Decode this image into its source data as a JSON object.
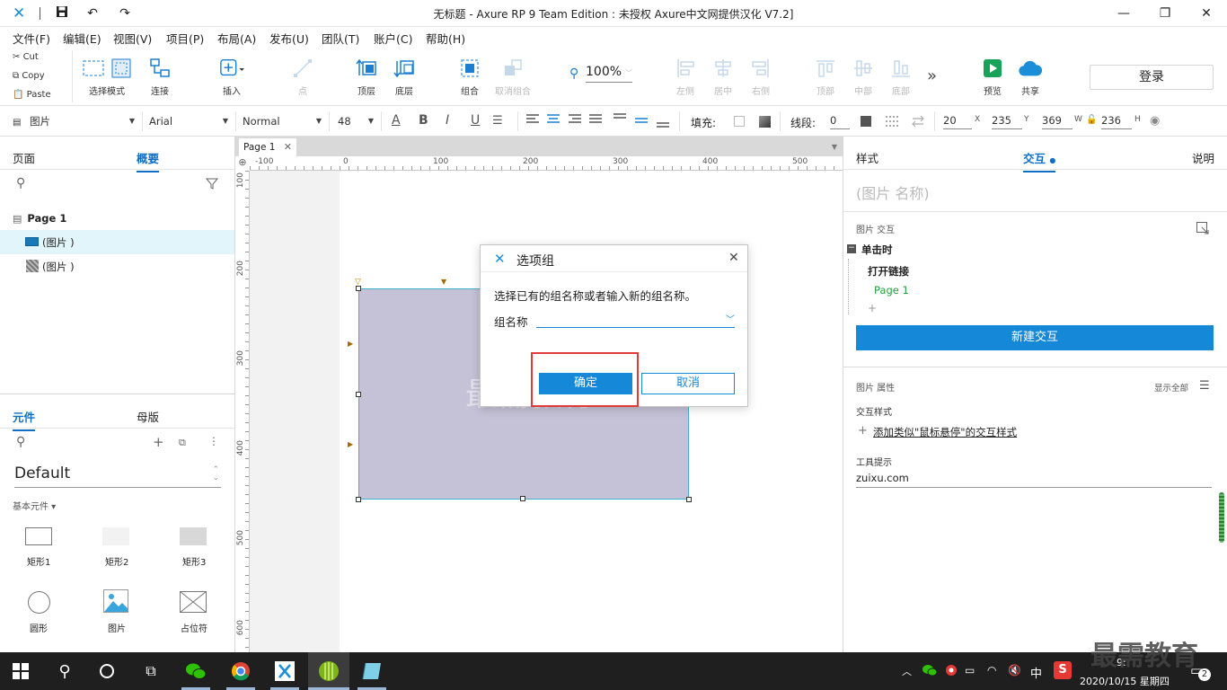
{
  "window": {
    "title": "无标题 - Axure RP 9 Team Edition : 未授权    Axure中文网提供汉化 V7.2]"
  },
  "menu": [
    "文件(F)",
    "编辑(E)",
    "视图(V)",
    "项目(P)",
    "布局(A)",
    "发布(U)",
    "团队(T)",
    "账户(C)",
    "帮助(H)"
  ],
  "clipboard": {
    "cut": "Cut",
    "copy": "Copy",
    "paste": "Paste"
  },
  "toolbar": {
    "select_mode": "选择模式",
    "connect": "连接",
    "insert": "插入",
    "point": "点",
    "front": "顶层",
    "back": "底层",
    "group": "组合",
    "ungroup": "取消组合",
    "zoom": "100%",
    "left": "左侧",
    "center": "居中",
    "right": "右侧",
    "top": "顶部",
    "middle": "中部",
    "bottom": "底部",
    "more": "»",
    "preview": "预览",
    "share": "共享",
    "login": "登录"
  },
  "format": {
    "widget_type": "图片",
    "font": "Arial",
    "weight": "Normal",
    "size": "48",
    "fill_label": "填充:",
    "stroke_label": "线段:",
    "stroke_value": "0",
    "w": "20",
    "x_label": "X",
    "x": "235",
    "y_label": "Y",
    "y": "369",
    "w_label": "W",
    "h": "236",
    "h_label": "H"
  },
  "left_panel": {
    "tab_pages": "页面",
    "tab_outline": "概要",
    "page_name": "Page 1",
    "items": [
      "(图片 )",
      "(图片 )"
    ],
    "tab_widgets": "元件",
    "tab_masters": "母版",
    "library": "Default",
    "category": "基本元件 ▾",
    "widgets": [
      "矩形1",
      "矩形2",
      "矩形3",
      "圆形",
      "图片",
      "占位符"
    ]
  },
  "canvas": {
    "tab": "Page 1",
    "hticks": [
      "-100",
      "0",
      "100",
      "200",
      "300",
      "400",
      "500"
    ],
    "vticks": [
      "100",
      "200",
      "300",
      "400",
      "500",
      "600"
    ],
    "watermark": "最需教育"
  },
  "dialog": {
    "title": "选项组",
    "prompt": "选择已有的组名称或者输入新的组名称。",
    "field_label": "组名称",
    "field_value": "",
    "ok": "确定",
    "cancel": "取消"
  },
  "right_panel": {
    "tab_style": "样式",
    "tab_interact": "交互",
    "tab_notes": "说明",
    "name_placeholder": "(图片 名称)",
    "section_interactions": "图片 交互",
    "event": "单击时",
    "action": "打开链接",
    "target": "Page 1",
    "add": "+",
    "new_interaction": "新建交互",
    "section_props": "图片 属性",
    "show_all": "显示全部",
    "interaction_style": "交互样式",
    "add_style": "添加类似\"鼠标悬停\"的交互样式",
    "tooltip_label": "工具提示",
    "tooltip_value": "zuixu.com"
  },
  "taskbar": {
    "ime": "中",
    "date": "2020/10/15 星期四",
    "time": "9:",
    "notif": "2",
    "brand": "最需教育"
  }
}
